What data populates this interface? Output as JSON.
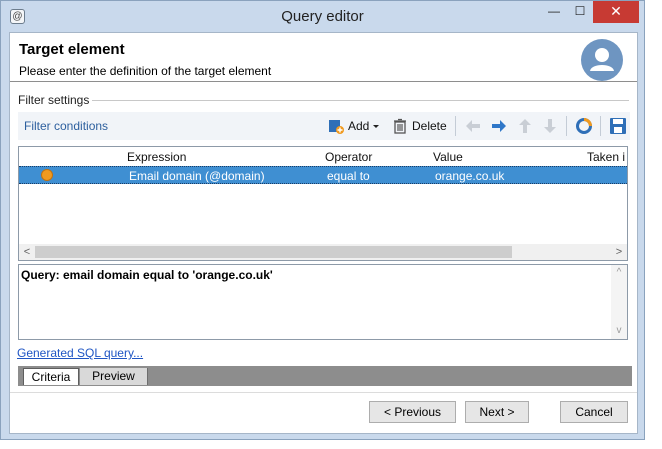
{
  "window": {
    "title": "Query editor",
    "minimize_glyph": "—",
    "maximize_glyph": "☐",
    "close_glyph": "✕",
    "app_icon": "app-logo-icon"
  },
  "header": {
    "title": "Target element",
    "subtitle": "Please enter the definition of the target element",
    "avatar_icon": "user-avatar-icon"
  },
  "filter": {
    "group_label": "Filter settings",
    "conditions_label": "Filter conditions",
    "toolbar": {
      "add_label": "Add",
      "delete_label": "Delete",
      "icons": [
        "add-icon",
        "dropdown-arrow-icon",
        "trash-icon",
        "arrow-left-icon",
        "arrow-right-icon",
        "arrow-up-icon",
        "arrow-down-icon",
        "refresh-icon",
        "save-icon"
      ]
    }
  },
  "grid": {
    "columns": [
      "Expression",
      "Operator",
      "Value",
      "Taken i"
    ],
    "rows": [
      {
        "expression": "Email domain (@domain)",
        "operator": "equal to",
        "value": "orange.co.uk",
        "status_color": "#f09a20",
        "selected": true
      }
    ]
  },
  "query": {
    "text": "Query: email domain equal to 'orange.co.uk'"
  },
  "sql_link": "Generated SQL query...",
  "tabs": [
    {
      "label": "Criteria",
      "active": true
    },
    {
      "label": "Preview",
      "active": false
    }
  ],
  "buttons": {
    "previous": "< Previous",
    "next": "Next >",
    "cancel": "Cancel"
  },
  "colors": {
    "selection": "#3f8fd2",
    "link": "#1f55c4",
    "close_button": "#c73a33",
    "avatar": "#6e95c1"
  }
}
